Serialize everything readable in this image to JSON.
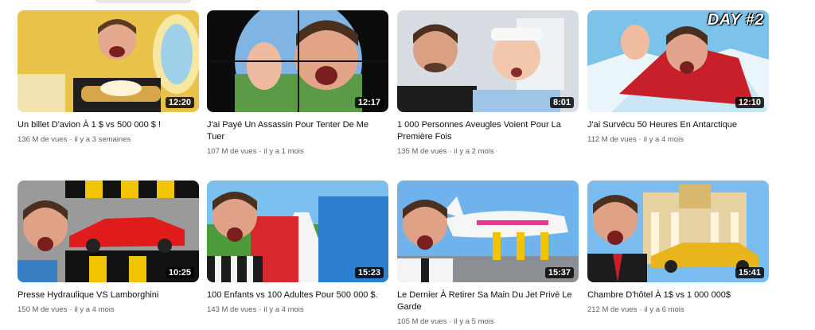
{
  "videos": [
    {
      "title": "Un billet D'avion À 1 $ vs 500 000 $ !",
      "views": "136 M de vues",
      "age": "il y a 3 semaines",
      "duration": "12:20"
    },
    {
      "title": "J'ai Payé Un Assassin Pour Tenter De Me Tuer",
      "views": "107 M de vues",
      "age": "il y a 1 mois",
      "duration": "12:17"
    },
    {
      "title": "1 000 Personnes Aveugles Voient Pour La Première Fois",
      "views": "135 M de vues",
      "age": "il y a 2 mois",
      "duration": "8:01"
    },
    {
      "title": "J'ai Survécu 50 Heures En Antarctique",
      "views": "112 M de vues",
      "age": "il y a 4 mois",
      "duration": "12:10",
      "overlay_text": "DAY #2"
    },
    {
      "title": "Presse Hydraulique VS Lamborghini",
      "views": "150 M de vues",
      "age": "il y a 4 mois",
      "duration": "10:25"
    },
    {
      "title": "100 Enfants vs 100 Adultes Pour 500 000 $.",
      "views": "143 M de vues",
      "age": "il y a 4 mois",
      "duration": "15:23"
    },
    {
      "title": "Le Dernier À Retirer Sa Main Du Jet Privé Le Garde",
      "views": "105 M de vues",
      "age": "il y a 5 mois",
      "duration": "15:37"
    },
    {
      "title": "Chambre D'hôtel À 1$ vs 1 000 000$",
      "views": "212 M de vues",
      "age": "il y a 6 mois",
      "duration": "15:41"
    }
  ]
}
